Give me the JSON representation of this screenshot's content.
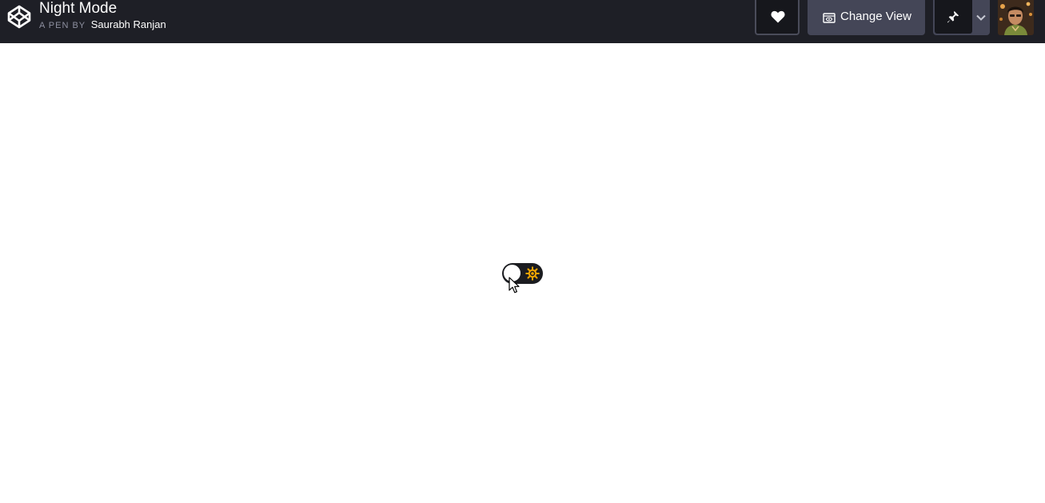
{
  "header": {
    "pen_title": "Night Mode",
    "byline_prefix": "A PEN BY",
    "author": "Saurabh Ranjan",
    "change_view_label": "Change View"
  },
  "toggle": {
    "state": "light",
    "icon": "sun-icon"
  },
  "colors": {
    "topbar_bg": "#1e1f26",
    "button_bg": "#444657",
    "toggle_bg": "#1b1c20",
    "sun": "#f5a700"
  }
}
